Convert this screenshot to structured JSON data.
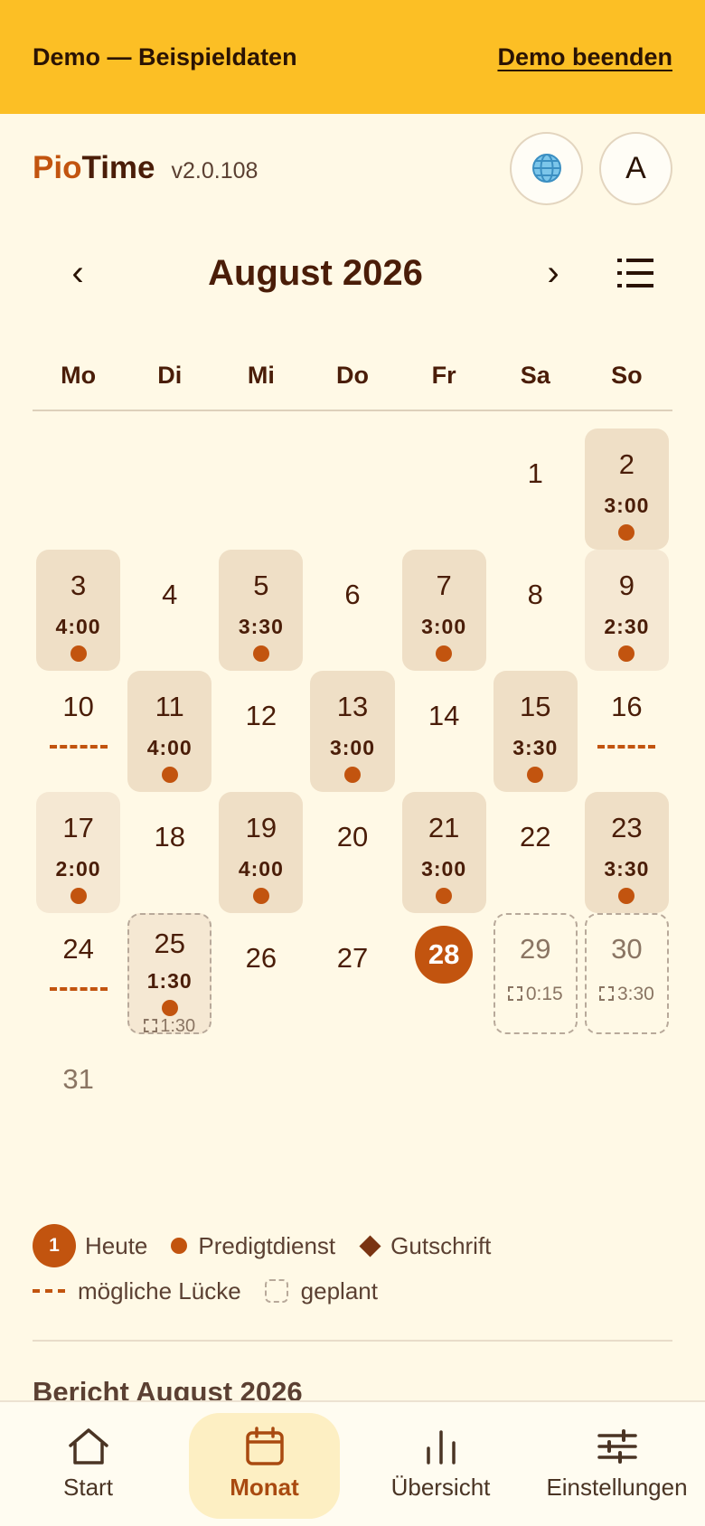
{
  "demo_banner": {
    "label": "Demo — Beispieldaten",
    "end_link": "Demo beenden"
  },
  "header": {
    "brand_prefix": "Pio",
    "brand_suffix": "Time",
    "version": "v2.0.108",
    "language_icon": "globe-icon",
    "avatar_initial": "A"
  },
  "calendar": {
    "prev": "‹",
    "next": "›",
    "title": "August 2026",
    "weekdays": [
      "Mo",
      "Di",
      "Mi",
      "Do",
      "Fr",
      "Sa",
      "So"
    ],
    "days": [
      {
        "d": "2",
        "h": "3:00"
      },
      {
        "d": "3",
        "h": "4:00"
      },
      {
        "d": "5",
        "h": "3:30"
      },
      {
        "d": "7",
        "h": "3:00"
      },
      {
        "d": "9",
        "h": "2:30"
      },
      {
        "d": "11",
        "h": "4:00"
      },
      {
        "d": "13",
        "h": "3:00"
      },
      {
        "d": "15",
        "h": "3:30"
      },
      {
        "d": "17",
        "h": "2:00"
      },
      {
        "d": "19",
        "h": "4:00"
      },
      {
        "d": "21",
        "h": "3:00"
      },
      {
        "d": "23",
        "h": "3:30"
      },
      {
        "d": "25",
        "h": "1:30",
        "plan": "1:30"
      },
      {
        "d": "29",
        "plan": "0:15"
      },
      {
        "d": "30",
        "plan": "3:30"
      }
    ],
    "plain": [
      "1",
      "4",
      "6",
      "8",
      "10",
      "12",
      "14",
      "16",
      "18",
      "20",
      "22",
      "24",
      "26",
      "27",
      "31"
    ],
    "today": "28"
  },
  "legend": {
    "today_sample": "1",
    "today": "Heute",
    "service": "Predigtdienst",
    "credit": "Gutschrift",
    "gap": "mögliche Lücke",
    "planned": "geplant"
  },
  "report": {
    "title": "Bericht August 2026"
  },
  "bottom_nav": {
    "start": "Start",
    "month": "Monat",
    "overview": "Übersicht",
    "settings": "Einstellungen"
  },
  "colors": {
    "banner": "#fcbf25",
    "accent": "#c2540f",
    "background": "#fff9e6"
  }
}
